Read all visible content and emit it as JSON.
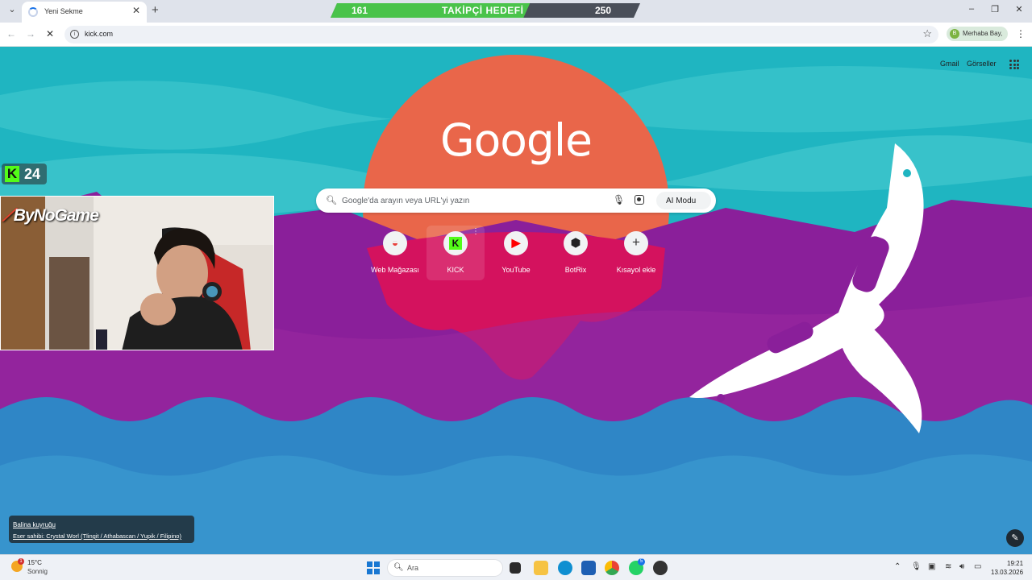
{
  "browser": {
    "tab_title": "Yeni Sekme",
    "url": "kick.com",
    "profile_label": "Merhaba Bay,",
    "profile_initial": "B"
  },
  "follower_goal": {
    "current": "161",
    "label": "TAKİPÇİ HEDEFİ",
    "target": "250",
    "progress": 0.644
  },
  "ntp": {
    "logo_text": "Google",
    "top_links": [
      "Gmail",
      "Görseller"
    ],
    "search_placeholder": "Google'da arayın veya URL'yi yazın",
    "ai_mode_label": "AI Modu",
    "shortcuts": [
      {
        "label": "Web Mağazası",
        "icon": "chrome-web-store-icon"
      },
      {
        "label": "KICK",
        "icon": "kick-icon"
      },
      {
        "label": "YouTube",
        "icon": "youtube-icon"
      },
      {
        "label": "BotRix",
        "icon": "botrix-icon"
      },
      {
        "label": "Kısayol ekle",
        "icon": "plus-icon"
      }
    ],
    "background_caption_title": "Balina kuyruğu",
    "background_caption_author": "Eser sahibi: Crystal Worl (Tlingit / Athabascan / Yupik / Filipino)"
  },
  "overlay": {
    "kick_viewers": "24",
    "kick_logo_letter": "K",
    "brand_name": "ByNoGame"
  },
  "taskbar": {
    "weather_temp": "15°C",
    "weather_desc": "Sonnig",
    "weather_badge": "1",
    "search_label": "Ara",
    "whatsapp_badge": "5",
    "time": "19:21",
    "date": "13.03.2026"
  },
  "colors": {
    "teal": "#1fb5c1",
    "purple": "#8a1f9a",
    "magenta": "#d4125e",
    "sun_orange": "#e9664a",
    "sea_blue": "#2f86c6",
    "kick_green": "#53fc18",
    "goal_green": "#49c34a"
  }
}
